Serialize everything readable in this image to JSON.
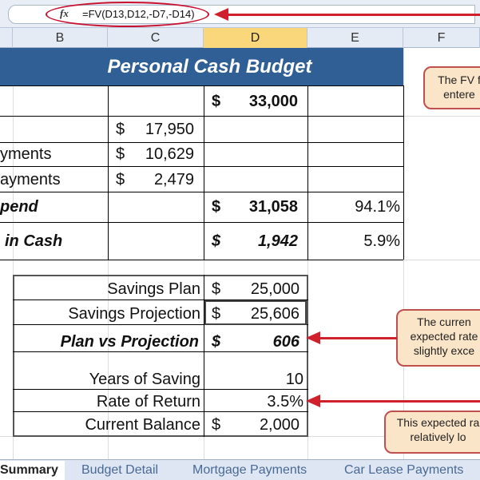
{
  "formula_bar": {
    "fx_label": "fx",
    "formula": "=FV(D13,D12,-D7,-D14)"
  },
  "columns": [
    "B",
    "C",
    "D",
    "E",
    "F"
  ],
  "title": "Personal Cash Budget",
  "rows": [
    {
      "label": "",
      "c": "",
      "d_sym": "$",
      "d": "33,000",
      "e": ""
    },
    {
      "label": "",
      "c_sym": "$",
      "c": "17,950"
    },
    {
      "label": "yments",
      "c_sym": "$",
      "c": "10,629"
    },
    {
      "label": "ayments",
      "c_sym": "$",
      "c": "2,479"
    },
    {
      "label": "pend",
      "d_sym": "$",
      "d": "31,058",
      "e": "94.1%"
    },
    {
      "label": "in Cash",
      "d_sym": "$",
      "d": "1,942",
      "e": "5.9%"
    }
  ],
  "savings": [
    {
      "label": "Savings Plan",
      "sym": "$",
      "value": "25,000"
    },
    {
      "label": "Savings Projection",
      "sym": "$",
      "value": "25,606"
    },
    {
      "label": "Plan vs Projection",
      "sym": "$",
      "value": "606"
    },
    {
      "label": "Years of Saving",
      "sym": "",
      "value": "10"
    },
    {
      "label": "Rate of Return",
      "sym": "",
      "value": "3.5%"
    },
    {
      "label": "Current Balance",
      "sym": "$",
      "value": "2,000"
    }
  ],
  "callouts": [
    {
      "line1": "The FV f",
      "line2": "entere"
    },
    {
      "line1": "The curren",
      "line2": "expected rate",
      "line3": "slightly exce"
    },
    {
      "line1": "This expected ra",
      "line2": "relatively lo"
    }
  ],
  "sheet_tabs": [
    "Summary",
    "Budget Detail",
    "Mortgage Payments",
    "Car Lease Payments"
  ],
  "colors": {
    "title_bg": "#2f5f95",
    "callout_bg": "#fbe5c8",
    "arrow": "#d0202e"
  }
}
